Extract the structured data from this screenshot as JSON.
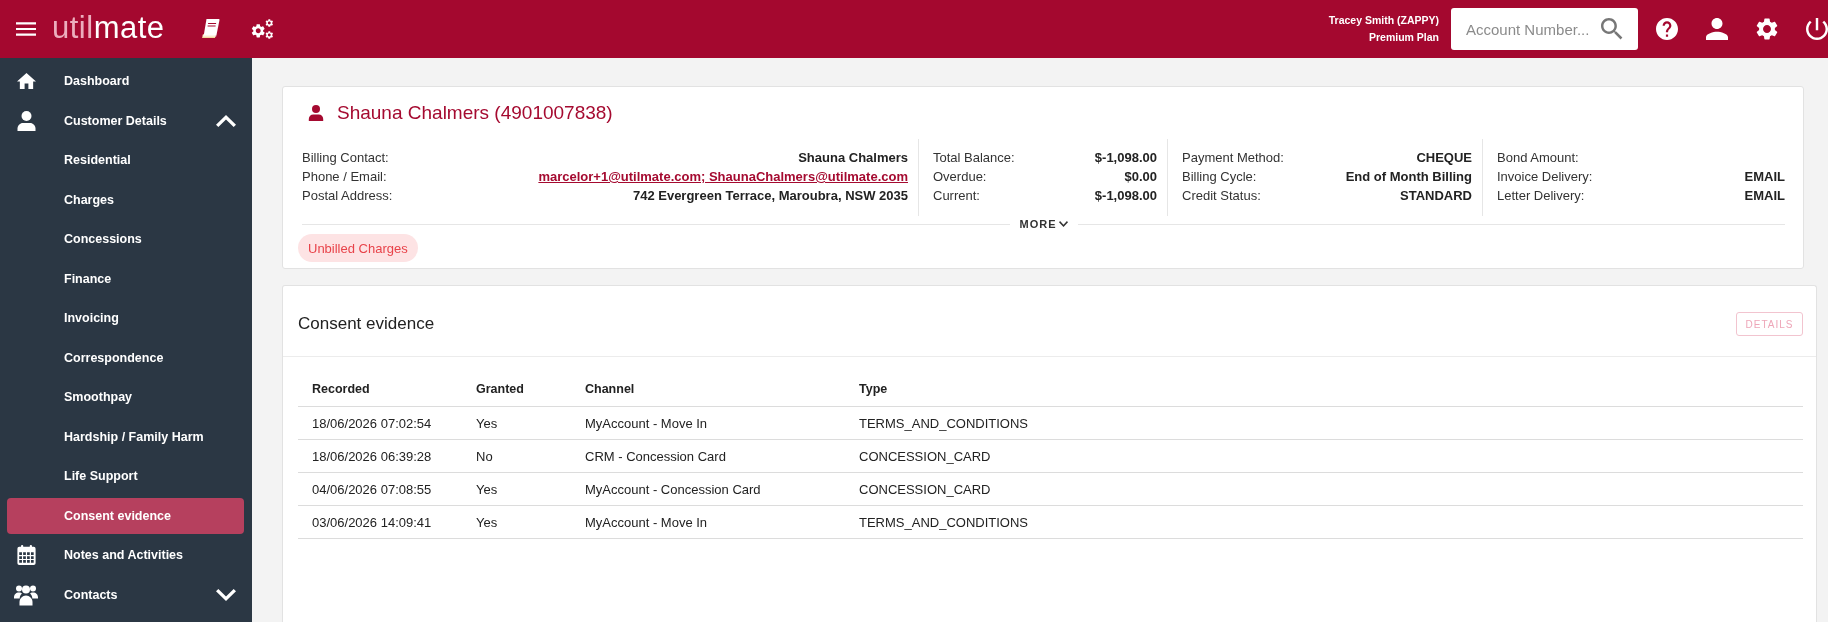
{
  "top_bar": {
    "logo": [
      "util",
      "mate"
    ],
    "user": {
      "name": "Tracey Smith (ZAPPY)",
      "plan": "Premium Plan"
    },
    "search": {
      "placeholder": "Account Number..."
    }
  },
  "sidebar": {
    "items": [
      {
        "label": "Dashboard",
        "selected": false
      },
      {
        "label": "Customer Details",
        "selected": false,
        "expanded": true,
        "children": [
          {
            "label": "Residential",
            "selected": false
          },
          {
            "label": "Charges",
            "selected": false
          },
          {
            "label": "Concessions",
            "selected": false
          },
          {
            "label": "Finance",
            "selected": false
          },
          {
            "label": "Invoicing",
            "selected": false
          },
          {
            "label": "Correspondence",
            "selected": false
          },
          {
            "label": "Smoothpay",
            "selected": false
          },
          {
            "label": "Hardship / Family Harm",
            "selected": false
          },
          {
            "label": "Life Support",
            "selected": false
          },
          {
            "label": "Consent evidence",
            "selected": true
          }
        ]
      },
      {
        "label": "Notes and Activities",
        "selected": false
      },
      {
        "label": "Contacts",
        "selected": false,
        "expanded": false
      }
    ]
  },
  "customer": {
    "name": "Shauna Chalmers (4901007838)",
    "details": [
      [
        {
          "label": "Billing Contact:",
          "value": "Shauna Chalmers",
          "kind": "text"
        },
        {
          "label": "Phone / Email:",
          "value": "marcelor+1@utilmate.com; ShaunaChalmers@utilmate.com",
          "kind": "link"
        },
        {
          "label": "Postal Address:",
          "value": "742 Evergreen Terrace, Maroubra, NSW 2035",
          "kind": "text"
        }
      ],
      [
        {
          "label": "Total Balance:",
          "value": "$-1,098.00",
          "kind": "text"
        },
        {
          "label": "Overdue:",
          "value": "$0.00",
          "kind": "text"
        },
        {
          "label": "Current:",
          "value": "$-1,098.00",
          "kind": "text"
        }
      ],
      [
        {
          "label": "Payment Method:",
          "value": "CHEQUE",
          "kind": "text"
        },
        {
          "label": "Billing Cycle:",
          "value": "End of Month Billing",
          "kind": "text"
        },
        {
          "label": "Credit Status:",
          "value": "STANDARD",
          "kind": "text"
        }
      ],
      [
        {
          "label": "Bond Amount:"
        },
        {
          "label": "Invoice Delivery:",
          "value": "EMAIL",
          "kind": "text"
        },
        {
          "label": "Letter Delivery:",
          "value": "EMAIL",
          "kind": "text"
        }
      ]
    ],
    "more": "MORE",
    "tags": [
      "Unbilled Charges"
    ]
  },
  "consent": {
    "title": "Consent evidence",
    "details_button": {
      "label": "DETAILS",
      "disabled": true
    },
    "table": {
      "columns": [
        "Recorded",
        "Granted",
        "Channel",
        "Type"
      ],
      "rows": [
        [
          "18/06/2026 07:02:54",
          "Yes",
          "MyAccount - Move In",
          "TERMS_AND_CONDITIONS"
        ],
        [
          "18/06/2026 06:39:28",
          "No",
          "CRM - Concession Card",
          "CONCESSION_CARD"
        ],
        [
          "04/06/2026 07:08:55",
          "Yes",
          "MyAccount - Concession Card",
          "CONCESSION_CARD"
        ],
        [
          "03/06/2026 14:09:41",
          "Yes",
          "MyAccount - Move In",
          "TERMS_AND_CONDITIONS"
        ]
      ]
    }
  }
}
